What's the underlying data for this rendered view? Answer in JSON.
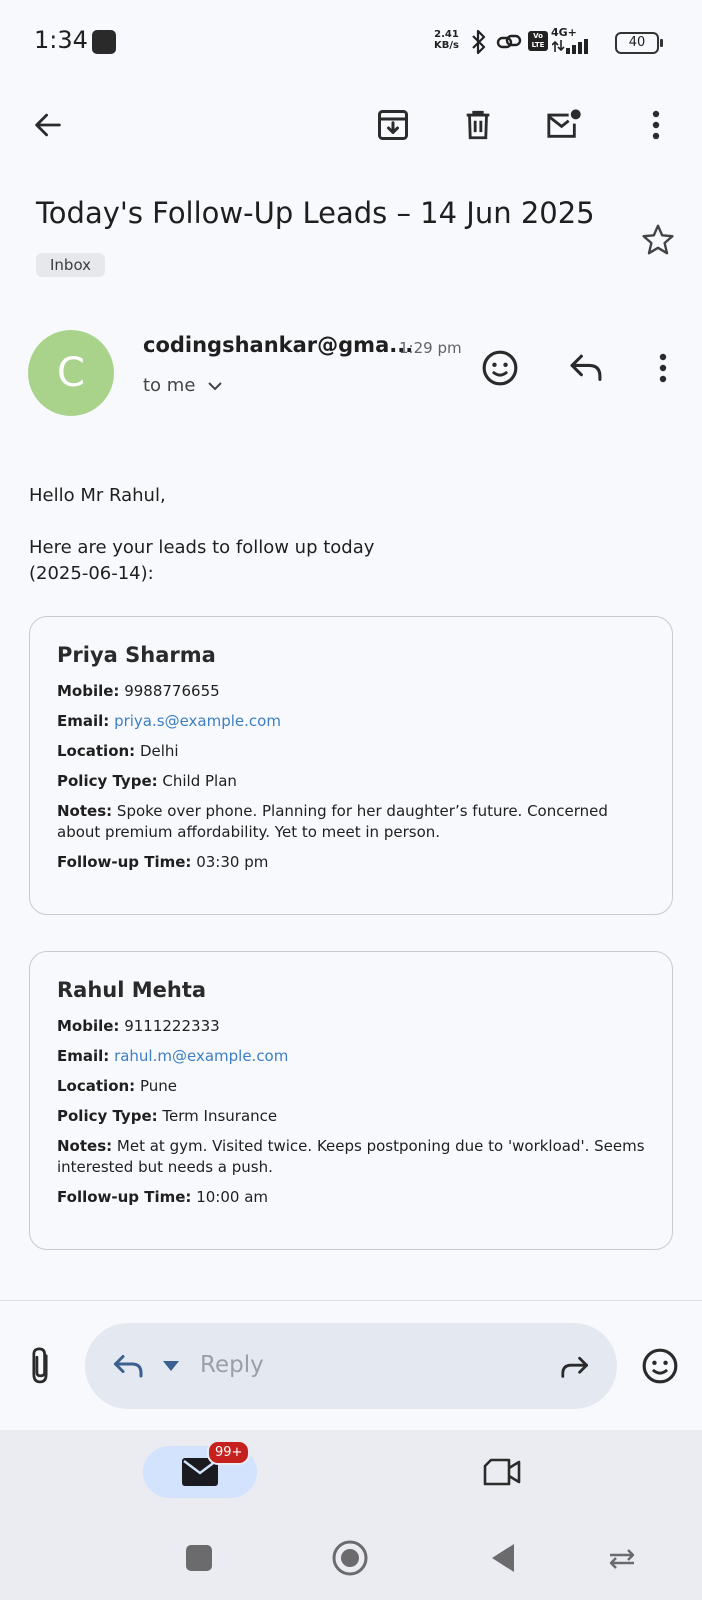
{
  "status_bar": {
    "time": "1:34",
    "net_speed_value": "2.41",
    "net_speed_unit": "KB/s",
    "network": "4G+",
    "volte": "Vo LTE",
    "battery": "40"
  },
  "toolbar": {
    "back_icon": "arrow-left-icon",
    "archive_icon": "archive-icon",
    "delete_icon": "trash-icon",
    "mark_unread_icon": "mail-unread-icon",
    "more_icon": "more-vert-icon"
  },
  "email": {
    "subject": "Today's Follow-Up Leads – 14 Jun 2025",
    "label": "Inbox",
    "sender": {
      "avatar_letter": "C",
      "avatar_color": "#a9d38b",
      "address": "codingshankar@gma...",
      "time": "1:29 pm",
      "to": "to me"
    },
    "greeting": "Hello Mr Rahul,",
    "intro_line1": "Here are your leads to follow up today",
    "intro_line2": "(2025-06-14):",
    "field_labels": {
      "mobile": "Mobile:",
      "email": "Email:",
      "location": "Location:",
      "policy_type": "Policy Type:",
      "notes": "Notes:",
      "followup": "Follow-up Time:"
    },
    "leads": [
      {
        "name": "Priya Sharma",
        "mobile": "9988776655",
        "email": "priya.s@example.com",
        "location": "Delhi",
        "policy_type": "Child Plan",
        "notes": "Spoke over phone. Planning for her daughter’s future. Concerned about premium affordability. Yet to meet in person.",
        "followup": "03:30 pm"
      },
      {
        "name": "Rahul Mehta",
        "mobile": "9111222333",
        "email": "rahul.m@example.com",
        "location": "Pune",
        "policy_type": "Term Insurance",
        "notes": "Met at gym. Visited twice. Keeps postponing due to 'workload'. Seems interested but needs a push.",
        "followup": "10:00 am"
      }
    ]
  },
  "reply_bar": {
    "placeholder": "Reply"
  },
  "bottom_nav": {
    "mail_badge": "99+",
    "accent": "#d3e3fd",
    "badge_color": "#c5221f"
  }
}
